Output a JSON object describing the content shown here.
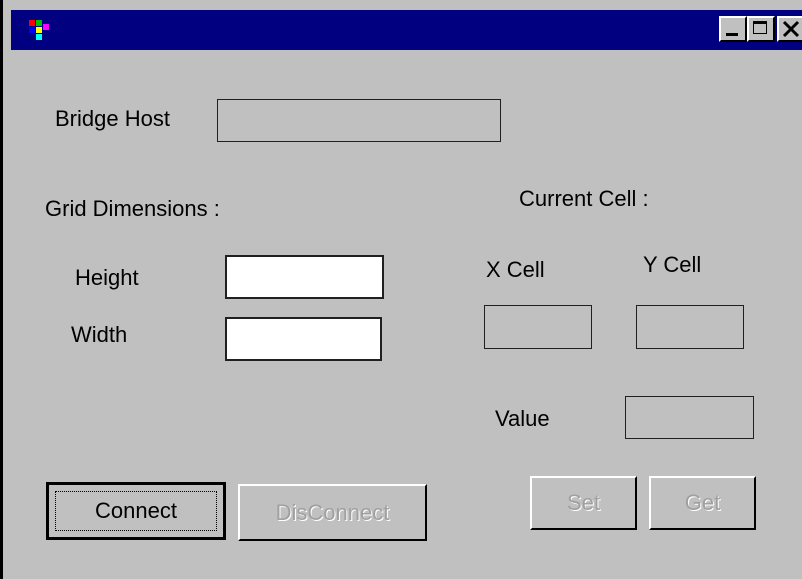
{
  "window": {
    "title": "",
    "controls": [
      "minimize",
      "maximize",
      "close"
    ]
  },
  "bridge_host": {
    "label": "Bridge Host",
    "value": ""
  },
  "grid_dimensions": {
    "label": "Grid Dimensions :",
    "height_label": "Height",
    "height_value": "",
    "width_label": "Width",
    "width_value": ""
  },
  "current_cell": {
    "label": "Current Cell :",
    "x_label": "X Cell",
    "x_value": "",
    "y_label": "Y Cell",
    "y_value": "",
    "value_label": "Value",
    "value_value": ""
  },
  "buttons": {
    "connect": "Connect",
    "disconnect": "DisConnect",
    "set": "Set",
    "get": "Get"
  },
  "colors": {
    "face": "#c0c0c0",
    "titlebar": "#000080",
    "disabled_text": "#a0a0a0"
  }
}
